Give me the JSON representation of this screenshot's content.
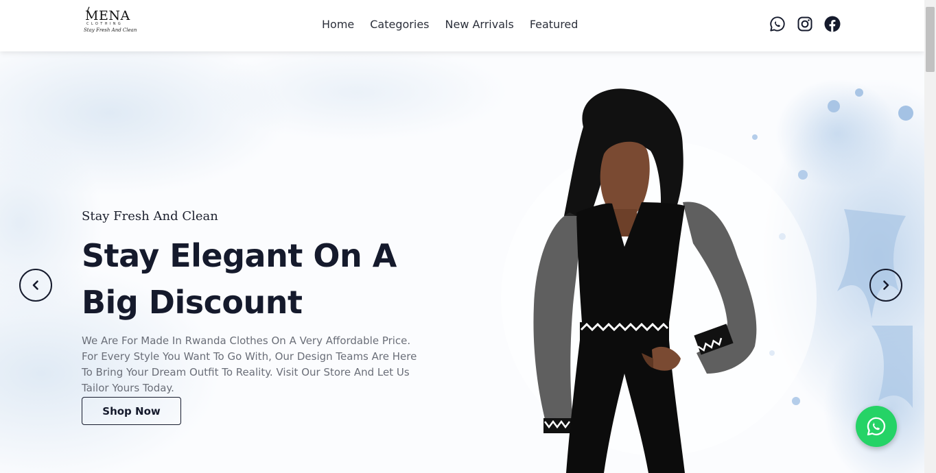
{
  "brand": {
    "name": "MENA",
    "sub": "CLOTHING",
    "tagline": "Stay Fresh And Clean"
  },
  "nav": {
    "items": [
      "Home",
      "Categories",
      "New Arrivals",
      "Featured"
    ]
  },
  "social": {
    "icons": [
      "whatsapp-icon",
      "instagram-icon",
      "facebook-icon"
    ]
  },
  "hero": {
    "tagline": "Stay Fresh And Clean",
    "title_line1": "Stay Elegant On A",
    "title_line2": "Big Discount",
    "description": "We Are For Made In Rwanda Clothes On A Very Affordable Price. For Every Style You Want To Go With, Our Design Teams Are Here To Bring Your Dream Outfit To Reality. Visit Our Store And Let Us Tailor Yours Today.",
    "cta": "Shop Now"
  },
  "colors": {
    "primary": "#151a2c",
    "whatsapp": "#25d366",
    "splash": "#b7cfe8"
  }
}
